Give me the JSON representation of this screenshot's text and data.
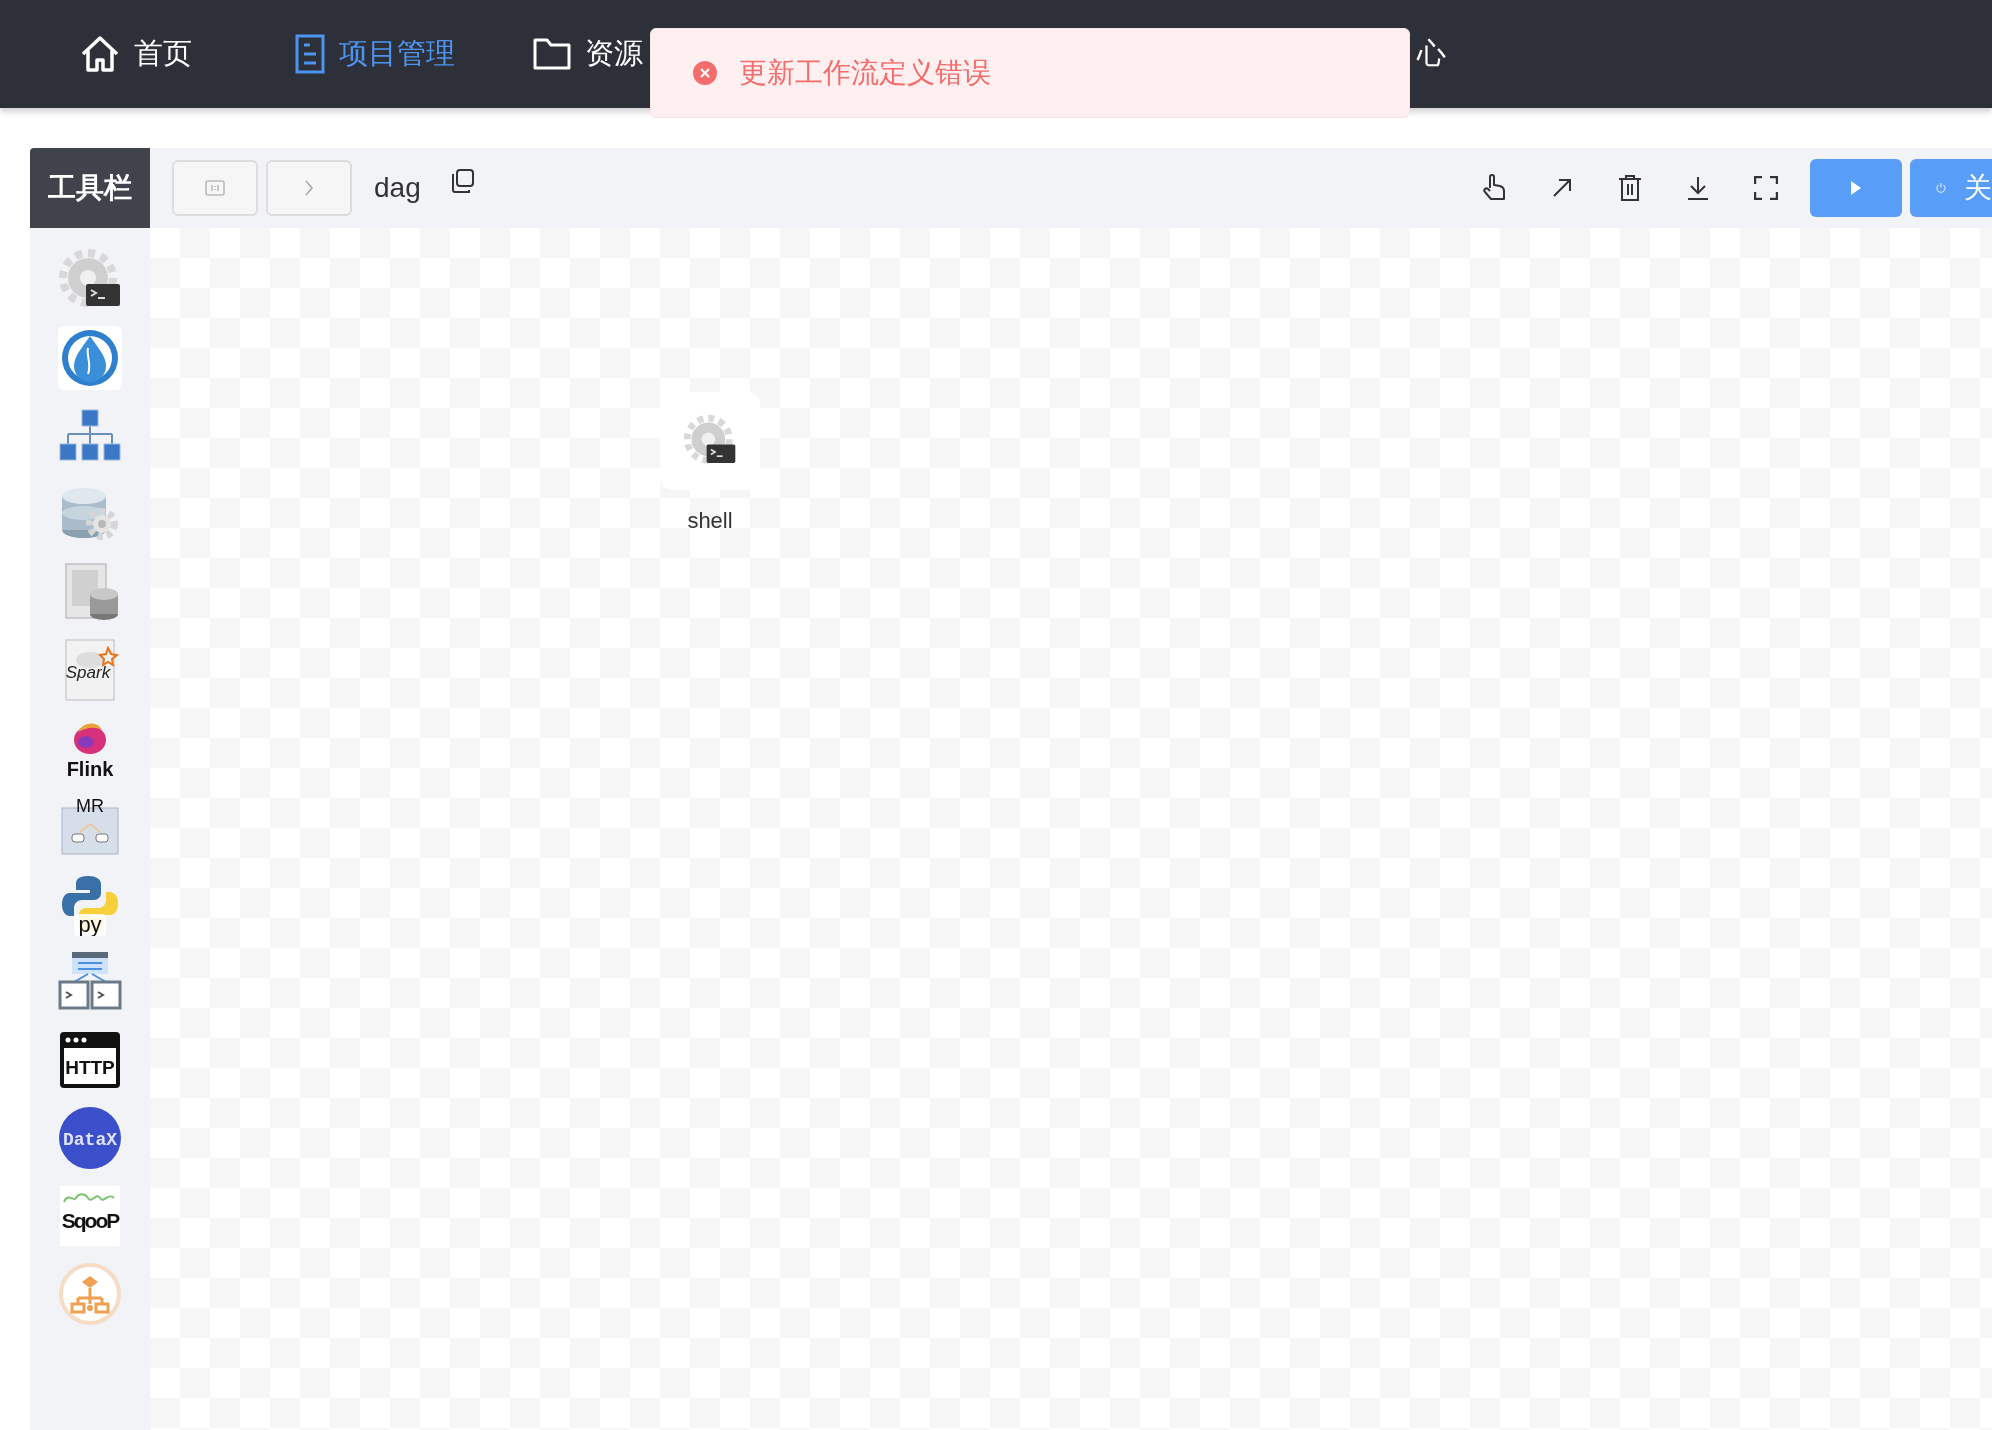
{
  "nav": {
    "items": [
      {
        "kind": "home",
        "label": "首页",
        "selected": false
      },
      {
        "kind": "project",
        "label": "项目管理",
        "selected": true
      },
      {
        "kind": "folder",
        "label": "资源",
        "selected": false
      },
      {
        "kind": "covered",
        "label": "心",
        "selected": false
      }
    ]
  },
  "toast": {
    "kind": "error",
    "message": "更新工作流定义错误"
  },
  "toolbar": {
    "title": "工具栏",
    "dag_name": "dag",
    "run_button": {
      "kind": "play"
    },
    "close_button": {
      "label": "关"
    }
  },
  "tools": [
    {
      "kind": "shell"
    },
    {
      "kind": "sub_process"
    },
    {
      "kind": "dependent"
    },
    {
      "kind": "sql"
    },
    {
      "kind": "procedure"
    },
    {
      "kind": "spark",
      "logo": "Spark"
    },
    {
      "kind": "flink",
      "logo": "Flink"
    },
    {
      "kind": "mr",
      "logo": "MR"
    },
    {
      "kind": "python",
      "logo": "py"
    },
    {
      "kind": "conditions"
    },
    {
      "kind": "http",
      "logo": "HTTP"
    },
    {
      "kind": "datax",
      "logo": "DataX"
    },
    {
      "kind": "sqoop",
      "logo": "SqooP"
    },
    {
      "kind": "switch"
    }
  ],
  "nodes": [
    {
      "kind": "shell",
      "label": "shell"
    }
  ]
}
